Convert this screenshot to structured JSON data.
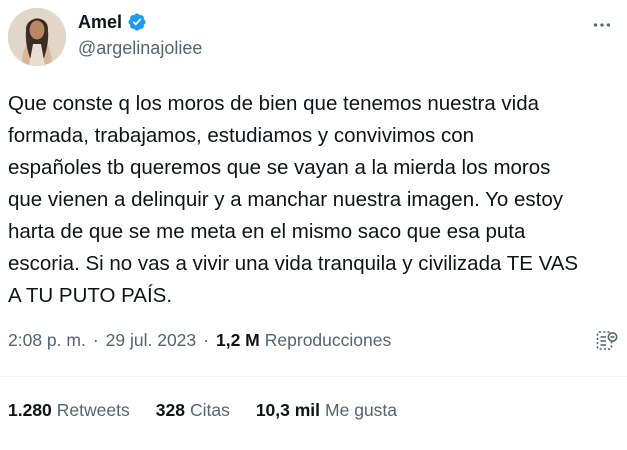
{
  "user": {
    "display_name": "Amel",
    "handle": "@argelinajoliee",
    "verified": true
  },
  "tweet": {
    "text": "Que conste q los moros de bien que tenemos nuestra vida\nformada, trabajamos, estudiamos y convivimos con\nespañoles tb queremos que se vayan a la mierda los moros\nque vienen a delinquir y a manchar nuestra imagen. Yo estoy\nharta de que se me meta en el mismo saco que esa puta\nescoria. Si no vas a vivir una vida tranquila y civilizada TE VAS\nA TU PUTO PAÍS.",
    "time": "2:08 p. m.",
    "date": "29 jul. 2023",
    "dot": "·",
    "views_count": "1,2 M",
    "views_label": "Reproducciones"
  },
  "stats": {
    "retweets_count": "1.280",
    "retweets_label": "Retweets",
    "quotes_count": "328",
    "quotes_label": "Citas",
    "likes_count": "10,3 mil",
    "likes_label": "Me gusta"
  },
  "icons": {
    "more": "more-horizontal-icon",
    "verified": "verified-badge-icon",
    "analytics": "analytics-icon"
  },
  "colors": {
    "verified": "#1d9bf0",
    "secondary_text": "#536471",
    "primary_text": "#0f1419"
  }
}
